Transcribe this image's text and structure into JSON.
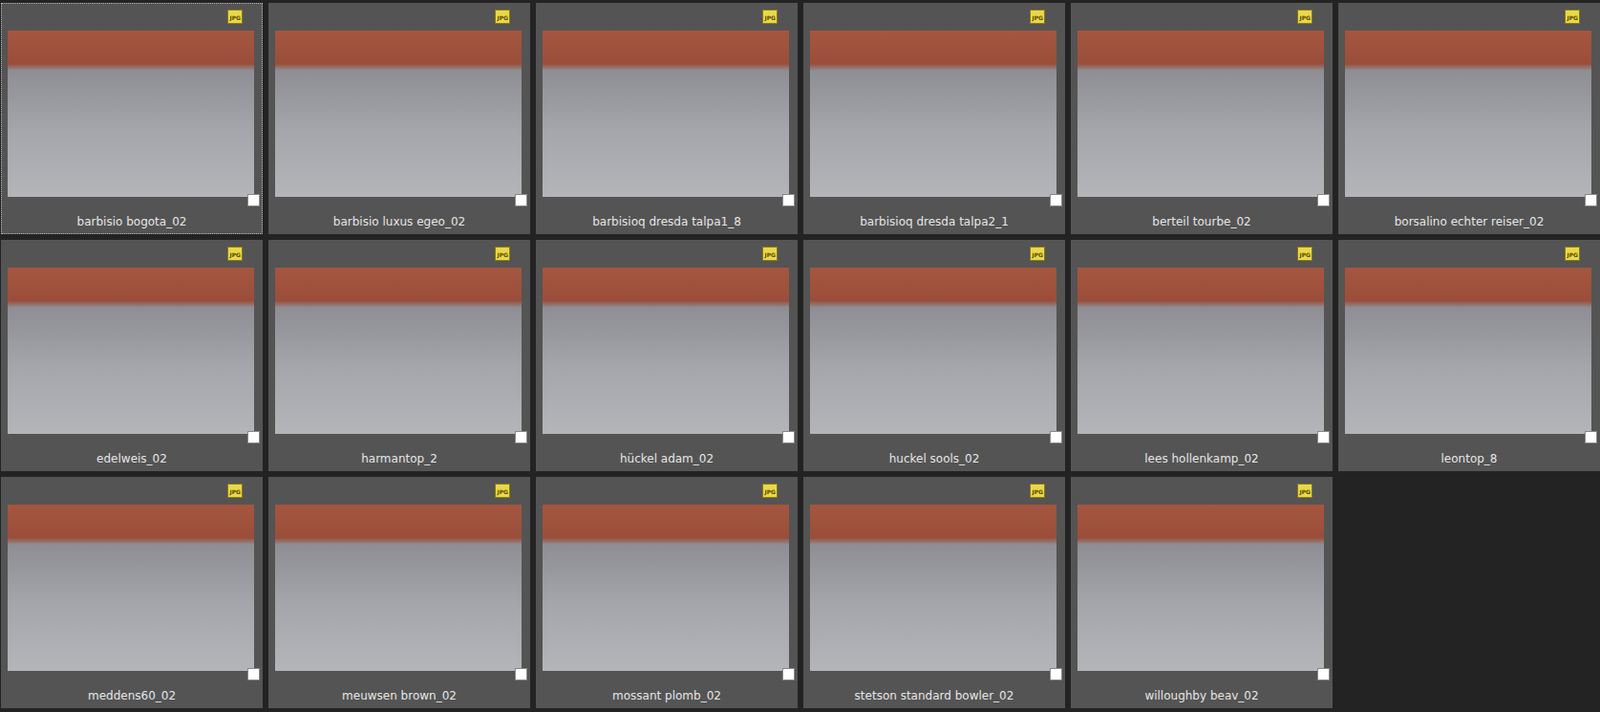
{
  "thumbnails": [
    {
      "name": "barbisio bogota_02",
      "badge": "JPG",
      "selected": true,
      "checked": false
    },
    {
      "name": "barbisio luxus egeo_02",
      "badge": "JPG",
      "selected": false,
      "checked": false
    },
    {
      "name": "barbisioq dresda talpa1_8",
      "badge": "JPG",
      "selected": false,
      "checked": false
    },
    {
      "name": "barbisioq dresda talpa2_1",
      "badge": "JPG",
      "selected": false,
      "checked": false
    },
    {
      "name": "berteil tourbe_02",
      "badge": "JPG",
      "selected": false,
      "checked": false
    },
    {
      "name": "borsalino echter reiser_02",
      "badge": "JPG",
      "selected": false,
      "checked": false
    },
    {
      "name": "edelweis_02",
      "badge": "JPG",
      "selected": false,
      "checked": false
    },
    {
      "name": "harmantop_2",
      "badge": "JPG",
      "selected": false,
      "checked": false
    },
    {
      "name": "hückel adam_02",
      "badge": "JPG",
      "selected": false,
      "checked": false
    },
    {
      "name": "huckel sools_02",
      "badge": "JPG",
      "selected": false,
      "checked": false
    },
    {
      "name": "lees hollenkamp_02",
      "badge": "JPG",
      "selected": false,
      "checked": false
    },
    {
      "name": "leontop_8",
      "badge": "JPG",
      "selected": false,
      "checked": false
    },
    {
      "name": "meddens60_02",
      "badge": "JPG",
      "selected": false,
      "checked": false
    },
    {
      "name": "meuwsen brown_02",
      "badge": "JPG",
      "selected": false,
      "checked": false
    },
    {
      "name": "mossant plomb_02",
      "badge": "JPG",
      "selected": false,
      "checked": false
    },
    {
      "name": "stetson standard bowler_02",
      "badge": "JPG",
      "selected": false,
      "checked": false
    },
    {
      "name": "willoughby beav_02",
      "badge": "JPG",
      "selected": false,
      "checked": false
    }
  ]
}
